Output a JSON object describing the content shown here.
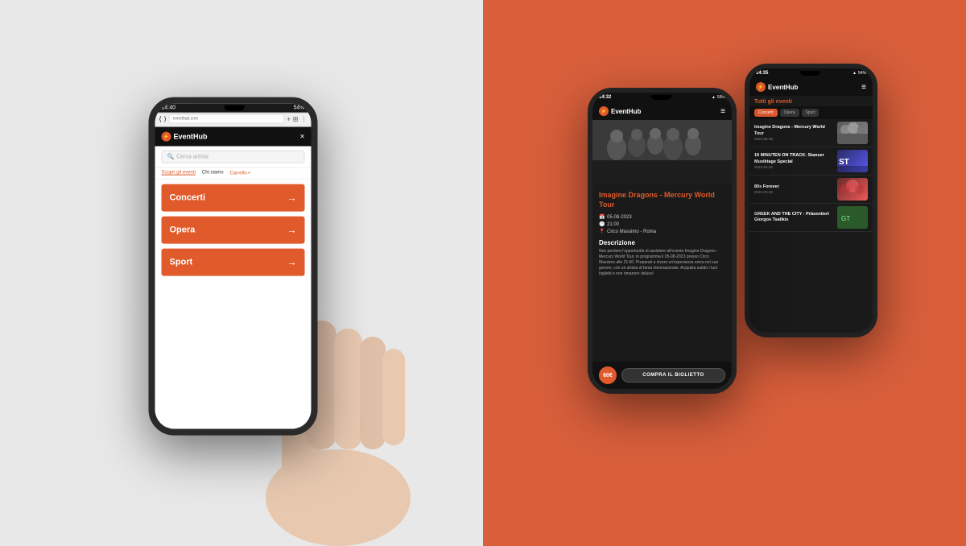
{
  "left": {
    "phone": {
      "time": "14:40",
      "battery": "54%",
      "app_name": "EventHub",
      "search_placeholder": "Cerca artista",
      "nav_items": [
        "Scopri gli eventi",
        "Chi siamo",
        "Carrello"
      ],
      "nav_active": "Scopri gli eventi",
      "close_label": "×",
      "menu_items": [
        {
          "label": "Concerti",
          "arrow": "→"
        },
        {
          "label": "Opera",
          "arrow": "→"
        },
        {
          "label": "Sport",
          "arrow": "→"
        }
      ]
    }
  },
  "right": {
    "phone_front": {
      "time": "14:32",
      "battery": "59%",
      "app_name": "EventHub",
      "event_title": "Imagine Dragons - Mercury World Tour",
      "event_date": "05-08-2023",
      "event_time": "21:00",
      "event_location": "Circo Massimo - Roma",
      "description_title": "Descrizione",
      "description_text": "Non perdere l'opportunità di assistere all'evento Imagine Dragons - Mercury World Tour, in programma il 05-08-2023 presso Circo Massimo alle 21:00. Preparati a vivere un'esperienza unica nel suo genere, con un artista di fama internazionale. Acquista subito i tuoi biglietti e non rimanere deluso!",
      "price": "60€",
      "buy_button": "COMPRA IL BIGLIETTO"
    },
    "phone_back": {
      "time": "14:35",
      "battery": "54%",
      "app_name": "EventHub",
      "section_title": "Tutti gli eventi",
      "filter_tabs": [
        "Concerti",
        "Opera",
        "Sport"
      ],
      "events": [
        {
          "title": "Imagine Dragons - Mercury World Tour",
          "date": "2023-06-05"
        },
        {
          "title": "18 MINUTEN ON TRACK: Stanser Musiktage Special",
          "date": "2023-04-32"
        },
        {
          "title": "80s Forever",
          "date": "2023-03-22"
        },
        {
          "title": "GREEK AND THE CITY - Präsentiert Giorgos Tsalikis",
          "date": ""
        }
      ]
    }
  }
}
